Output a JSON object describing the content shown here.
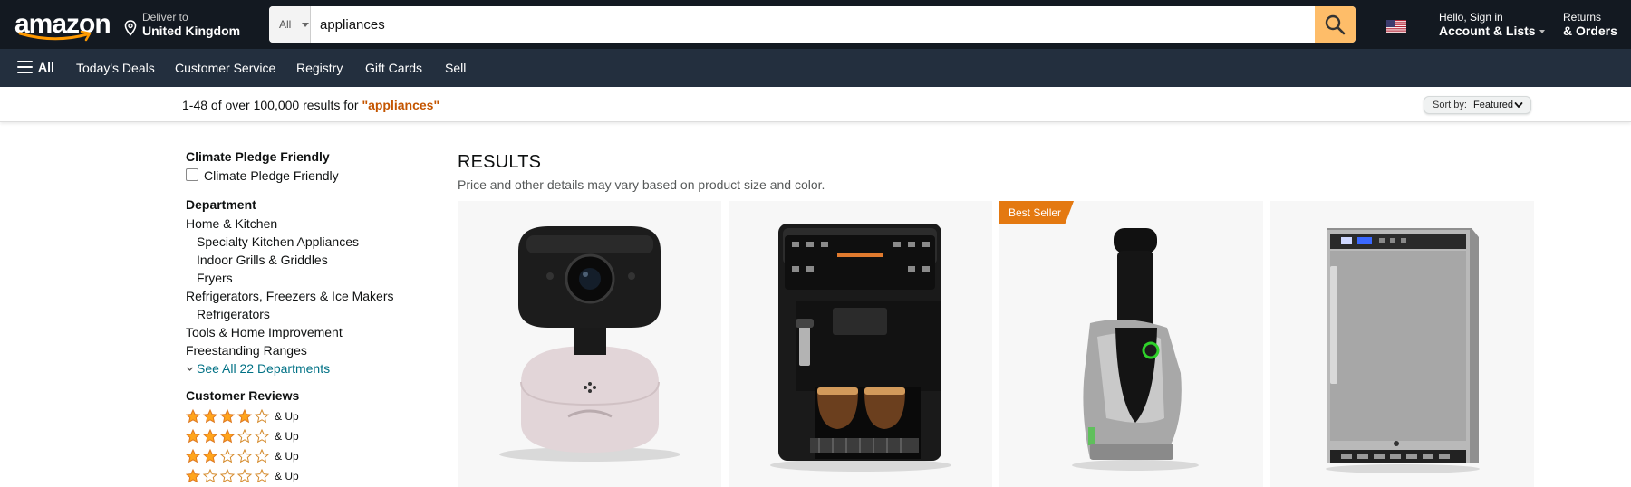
{
  "header": {
    "logo_text": "amazon",
    "deliver_small": "Deliver to",
    "deliver_big": "United Kingdom",
    "search_category": "All",
    "search_value": "appliances",
    "account_small": "Hello, Sign in",
    "account_big": "Account & Lists",
    "returns_small": "Returns",
    "returns_big": "& Orders"
  },
  "subnav": {
    "all_label": "All",
    "links": [
      "Today's Deals",
      "Customer Service",
      "Registry",
      "Gift Cards",
      "Sell"
    ]
  },
  "results_bar": {
    "count_text": "1-48 of over 100,000 results for ",
    "query": "\"appliances\"",
    "sort_label": "Sort by:",
    "sort_value": "Featured"
  },
  "sidebar": {
    "climate_head": "Climate Pledge Friendly",
    "climate_option": "Climate Pledge Friendly",
    "department_head": "Department",
    "departments": [
      "Home & Kitchen",
      "Specialty Kitchen Appliances",
      "Indoor Grills & Griddles",
      "Fryers",
      "Refrigerators, Freezers & Ice Makers",
      "Refrigerators",
      "Tools & Home Improvement",
      "Freestanding Ranges"
    ],
    "see_all": "See All 22 Departments",
    "reviews_head": "Customer Reviews",
    "and_up": "& Up",
    "review_ratings": [
      4,
      3,
      2,
      1
    ]
  },
  "main": {
    "title": "RESULTS",
    "subtitle": "Price and other details may vary based on product size and color.",
    "badge": "Best Seller",
    "products": [
      {
        "image": "security-camera"
      },
      {
        "image": "espresso-machine"
      },
      {
        "image": "frozen-dessert-maker"
      },
      {
        "image": "beverage-refrigerator"
      }
    ]
  },
  "colors": {
    "nav_dark": "#131921",
    "nav_sub": "#232f3e",
    "search_button": "#febd69",
    "query_orange": "#c45500",
    "link_teal": "#007185",
    "badge_orange": "#e47911",
    "star": "#ffa41c"
  }
}
